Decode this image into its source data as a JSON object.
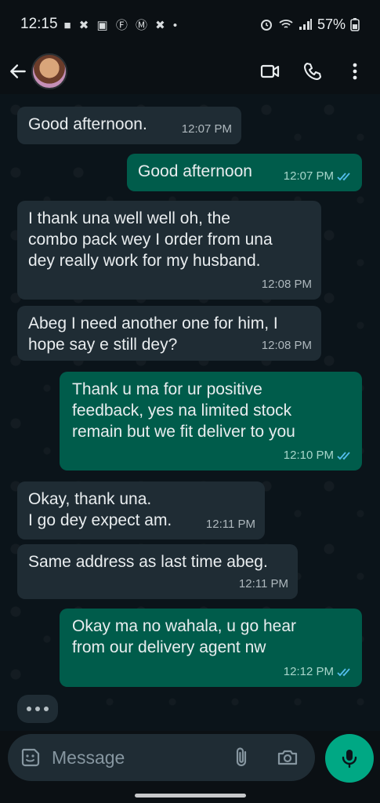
{
  "status_bar": {
    "time": "12:15",
    "notification_icons": "■ ✖ ▣ Ⓕ Ⓜ ✖ •",
    "battery_percent": "57%"
  },
  "header": {
    "contact_avatar": "contact-avatar",
    "icons": [
      "back-arrow-icon",
      "video-call-icon",
      "phone-icon",
      "more-options-icon"
    ]
  },
  "messages": [
    {
      "dir": "in",
      "text": "Good afternoon.",
      "time": "12:07 PM"
    },
    {
      "dir": "out",
      "text": "Good afternoon",
      "time": "12:07 PM",
      "read": true
    },
    {
      "dir": "in",
      "text": "I thank una well well oh, the\ncombo pack wey I order from una\ndey really work for my husband.",
      "time": "12:08 PM"
    },
    {
      "dir": "in",
      "text": "Abeg I need another one for him, I\nhope say e still dey?",
      "time": "12:08 PM"
    },
    {
      "dir": "out",
      "text": "Thank u ma for ur positive\nfeedback, yes na limited stock\nremain but we fit deliver to you",
      "time": "12:10 PM",
      "read": true
    },
    {
      "dir": "in",
      "text": "Okay, thank una.\nI go dey expect am.",
      "time": "12:11 PM"
    },
    {
      "dir": "in",
      "text": "Same address as last time abeg.",
      "time": "12:11 PM"
    },
    {
      "dir": "out",
      "text": "Okay ma no wahala, u go hear\nfrom our delivery agent nw",
      "time": "12:12 PM",
      "read": true
    }
  ],
  "composer": {
    "placeholder": "Message"
  },
  "colors": {
    "incoming_bubble": "#1f2c34",
    "outgoing_bubble": "#005c4b",
    "accent": "#00a884",
    "read_ticks": "#53bdeb"
  }
}
